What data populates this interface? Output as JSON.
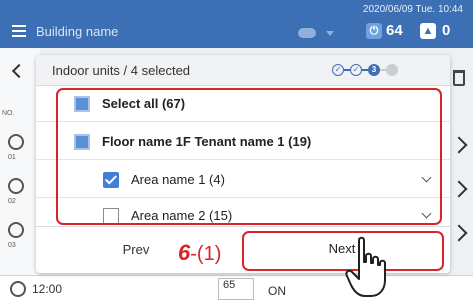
{
  "header": {
    "building_name": "Building name",
    "datetime": "2020/06/09 Tue. 10:44",
    "on_count": "64",
    "alarm_count": "0",
    "on_icon": "power-icon",
    "alarm_icon": "alarm-icon"
  },
  "background": {
    "column_label": "NO.",
    "row_numbers": [
      "01",
      "02",
      "03"
    ],
    "bottom_time": "12:00",
    "bottom_value": "65",
    "bottom_status": "ON"
  },
  "dialog": {
    "title": "Indoor units / 4 selected",
    "steps": [
      "1",
      "2",
      "3",
      "4"
    ],
    "current_step": 3,
    "rows": [
      {
        "label": "Select all (67)",
        "state": "indeterminate",
        "level": 0
      },
      {
        "label": "Floor name 1F Tenant name 1 (19)",
        "state": "indeterminate",
        "level": 0
      },
      {
        "label": "Area name 1 (4)",
        "state": "checked",
        "level": 1
      },
      {
        "label": "Area name 2 (15)",
        "state": "unchecked",
        "level": 1
      }
    ],
    "prev_label": "Prev",
    "next_label": "Next"
  },
  "annotation": {
    "step_number": "6",
    "step_sub": "-(1)",
    "highlight_color": "#d8232a"
  },
  "colors": {
    "header_blue": "#3d6fb4",
    "checkbox_blue": "#3d7fd9",
    "annotation_red": "#d8232a"
  }
}
